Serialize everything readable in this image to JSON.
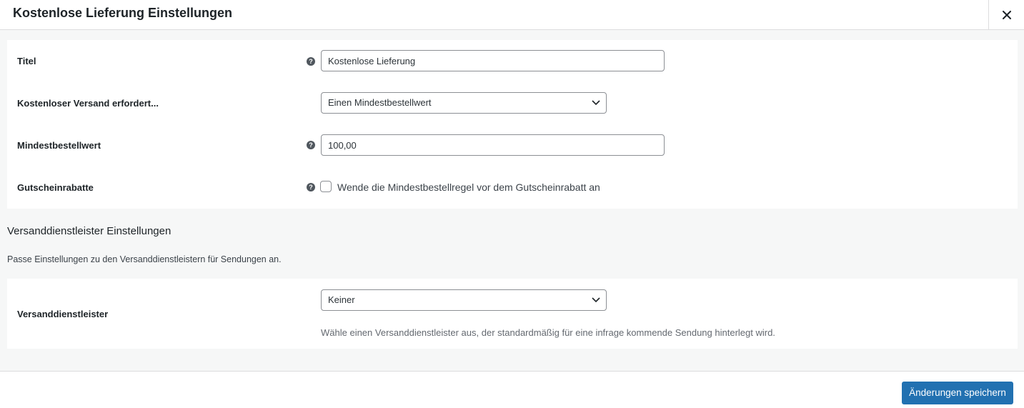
{
  "modal": {
    "title": "Kostenlose Lieferung Einstellungen",
    "close_icon": "close-icon"
  },
  "general": {
    "title_field": {
      "label": "Titel",
      "value": "Kostenlose Lieferung",
      "help_icon": "help-icon"
    },
    "requires_field": {
      "label": "Kostenloser Versand erfordert...",
      "selected": "Einen Mindestbestellwert"
    },
    "min_amount_field": {
      "label": "Mindestbestellwert",
      "value": "100,00",
      "help_icon": "help-icon"
    },
    "coupons_field": {
      "label": "Gutscheinrabatte",
      "checked": false,
      "checkbox_label": "Wende die Mindestbestellregel vor dem Gutscheinrabatt an",
      "help_icon": "help-icon"
    }
  },
  "carrier_section": {
    "title": "Versanddienstleister Einstellungen",
    "description": "Passe Einstellungen zu den Versanddienstleistern für Sendungen an.",
    "carrier_field": {
      "label": "Versanddienstleister",
      "selected": "Keiner",
      "description": "Wähle einen Versanddienstleister aus, der standardmäßig für eine infrage kommende Sendung hinterlegt wird."
    }
  },
  "footer": {
    "save_label": "Änderungen speichern"
  },
  "colors": {
    "primary": "#2271b1",
    "border": "#dcdcde",
    "background": "#f6f7f7"
  }
}
